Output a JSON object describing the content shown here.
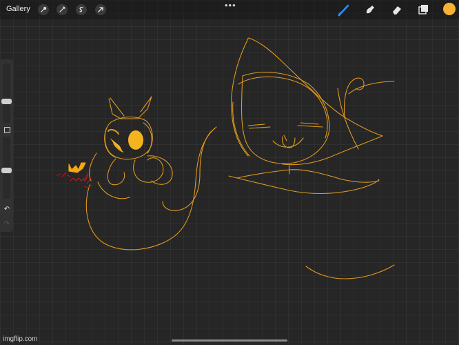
{
  "toolbar": {
    "gallery_label": "Gallery",
    "left_tools": [
      {
        "icon": "wrench-icon",
        "name": "actions"
      },
      {
        "icon": "magic-wand-icon",
        "name": "adjustments"
      },
      {
        "icon": "selection-icon",
        "name": "selection"
      },
      {
        "icon": "transform-arrow-icon",
        "name": "transform"
      }
    ],
    "more_glyph": "•••",
    "right_tools": [
      {
        "icon": "brush-icon",
        "name": "paint",
        "active": true
      },
      {
        "icon": "smudge-icon",
        "name": "smudge"
      },
      {
        "icon": "eraser-icon",
        "name": "eraser"
      },
      {
        "icon": "layers-icon",
        "name": "layers"
      }
    ],
    "current_color": "#f9b233"
  },
  "sidebar": {
    "brush_size_level": 0.35,
    "opacity_level": 0.45,
    "undo_glyph": "↶",
    "redo_glyph": "↷"
  },
  "canvas": {
    "stroke_color": "#e09a1e",
    "accent_fill": "#f5b41f",
    "scribble_color": "#d11a1a"
  },
  "watermark": "imgflip.com"
}
